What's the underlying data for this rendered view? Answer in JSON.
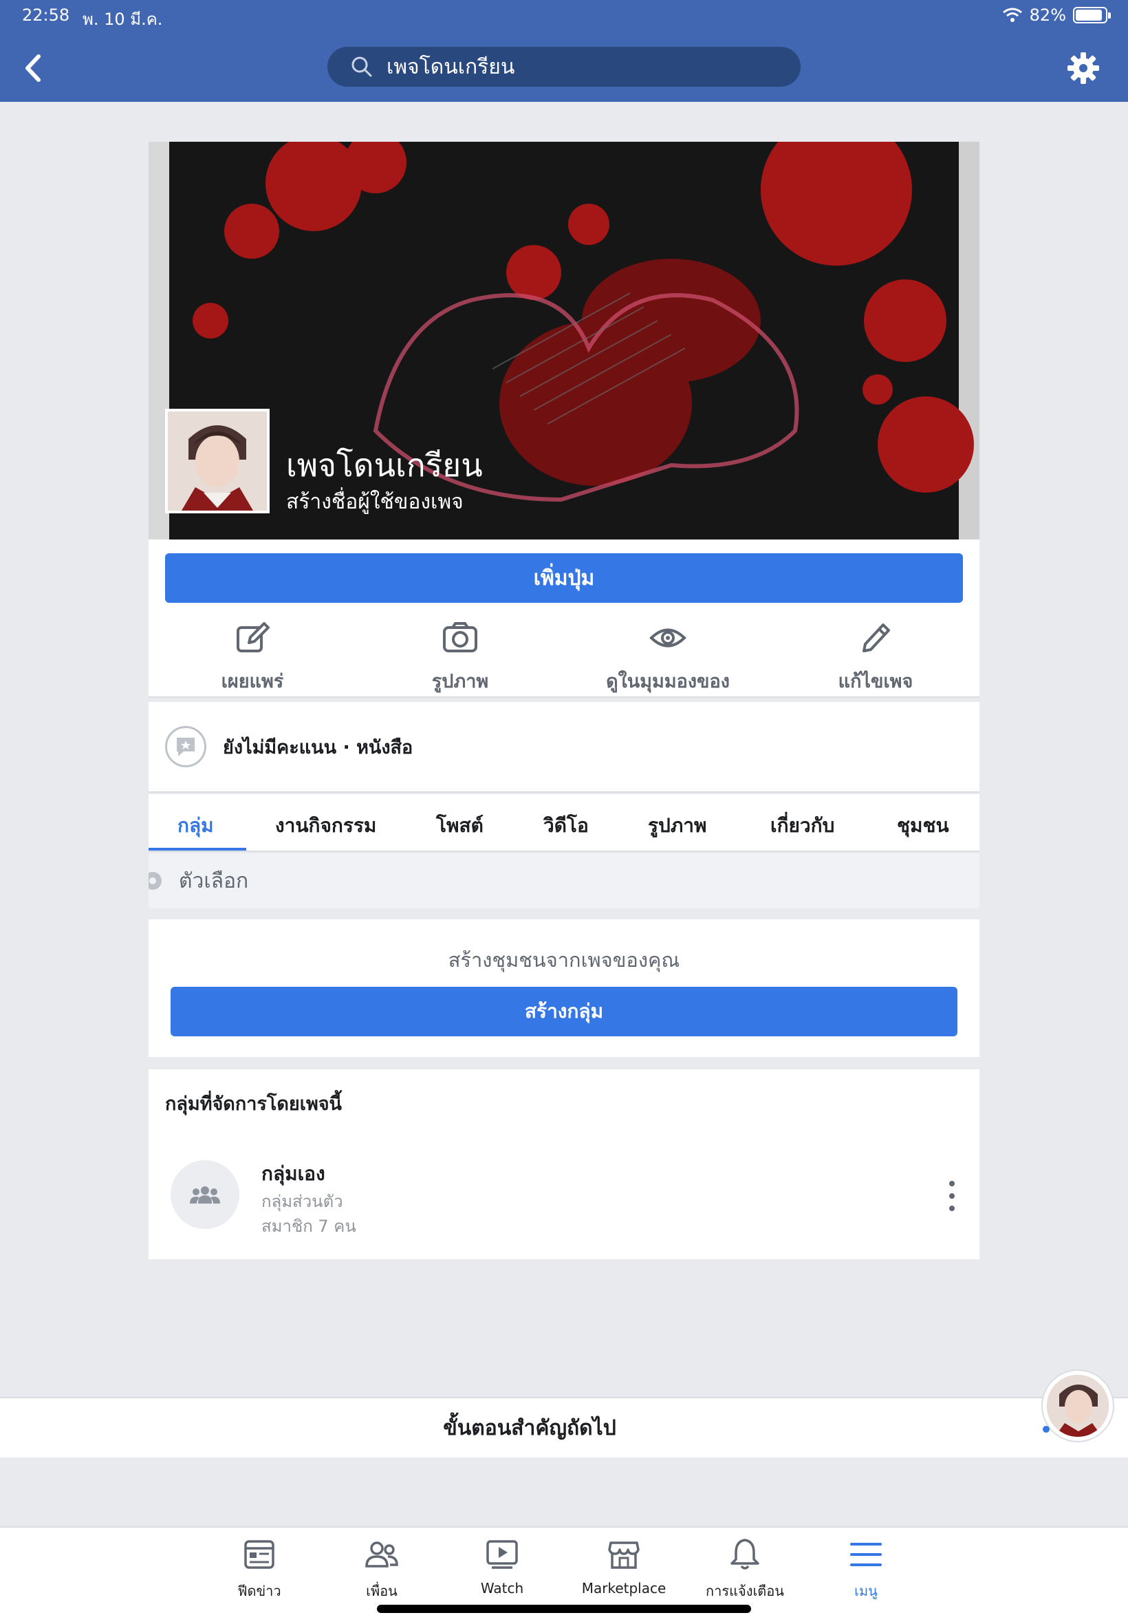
{
  "status": {
    "time": "22:58",
    "date": "พ. 10 มี.ค.",
    "battery": "82%"
  },
  "header": {
    "search_text": "เพจโดนเกรียน"
  },
  "page": {
    "name": "เพจโดนเกรียน",
    "username_prompt": "สร้างชื่อผู้ใช้ของเพจ",
    "add_button": "เพิ่มปุ่ม"
  },
  "actions": [
    {
      "label": "เผยแพร่",
      "icon": "edit-icon"
    },
    {
      "label": "รูปภาพ",
      "icon": "camera-icon"
    },
    {
      "label": "ดูในมุมมองของ",
      "icon": "eye-icon"
    },
    {
      "label": "แก้ไขเพจ",
      "icon": "pencil-icon"
    }
  ],
  "rating": {
    "text": "ยังไม่มีคะแนน · หนังสือ"
  },
  "tabs": [
    "กลุ่ม",
    "งานกิจกรรม",
    "โพสต์",
    "วิดีโอ",
    "รูปภาพ",
    "เกี่ยวกับ",
    "ชุมชน"
  ],
  "active_tab": "กลุ่ม",
  "options": {
    "label": "ตัวเลือก"
  },
  "community": {
    "title": "สร้างชุมชนจากเพจของคุณ",
    "button": "สร้างกลุ่ม"
  },
  "groups": {
    "header": "กลุ่มที่จัดการโดยเพจนี้",
    "items": [
      {
        "name": "กลุ่มเอง",
        "type": "กลุ่มส่วนตัว",
        "members": "สมาชิก 7 คน"
      }
    ]
  },
  "next_steps": "ขั้นตอนสำคัญถัดไป",
  "bottom_nav": [
    {
      "label": "ฟีดข่าว",
      "icon": "news-feed-icon"
    },
    {
      "label": "เพื่อน",
      "icon": "friends-icon"
    },
    {
      "label": "Watch",
      "icon": "watch-icon"
    },
    {
      "label": "Marketplace",
      "icon": "marketplace-icon"
    },
    {
      "label": "การแจ้งเตือน",
      "icon": "bell-icon"
    },
    {
      "label": "เมนู",
      "icon": "menu-icon"
    }
  ],
  "colors": {
    "brand": "#4267b2",
    "accent": "#3578e5",
    "cover_red": "#b01818"
  }
}
